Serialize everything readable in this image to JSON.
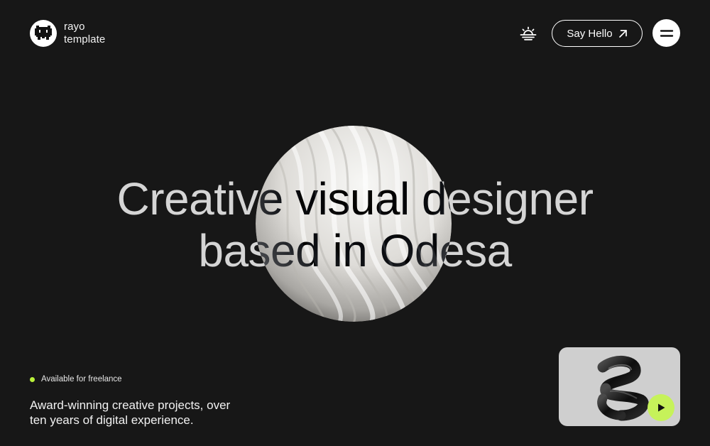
{
  "brand": {
    "line1": "rayo",
    "line2": "template",
    "logo_icon": "pixel-cat-icon"
  },
  "header": {
    "theme_toggle_icon": "sunrise-icon",
    "cta_label": "Say Hello",
    "cta_icon": "arrow-up-right-icon",
    "menu_icon": "menu-icon"
  },
  "hero": {
    "headline_line1": "Creative visual designer",
    "headline_line2": "based in Odesa"
  },
  "footer": {
    "availability": "Available for freelance",
    "tagline_line1": "Award-winning creative projects, over",
    "tagline_line2": "ten years of digital experience.",
    "video_play_icon": "play-icon"
  },
  "colors": {
    "background": "#171717",
    "accent": "#c6f25a",
    "status_dot": "#b9f13a",
    "text": "#ffffff"
  }
}
